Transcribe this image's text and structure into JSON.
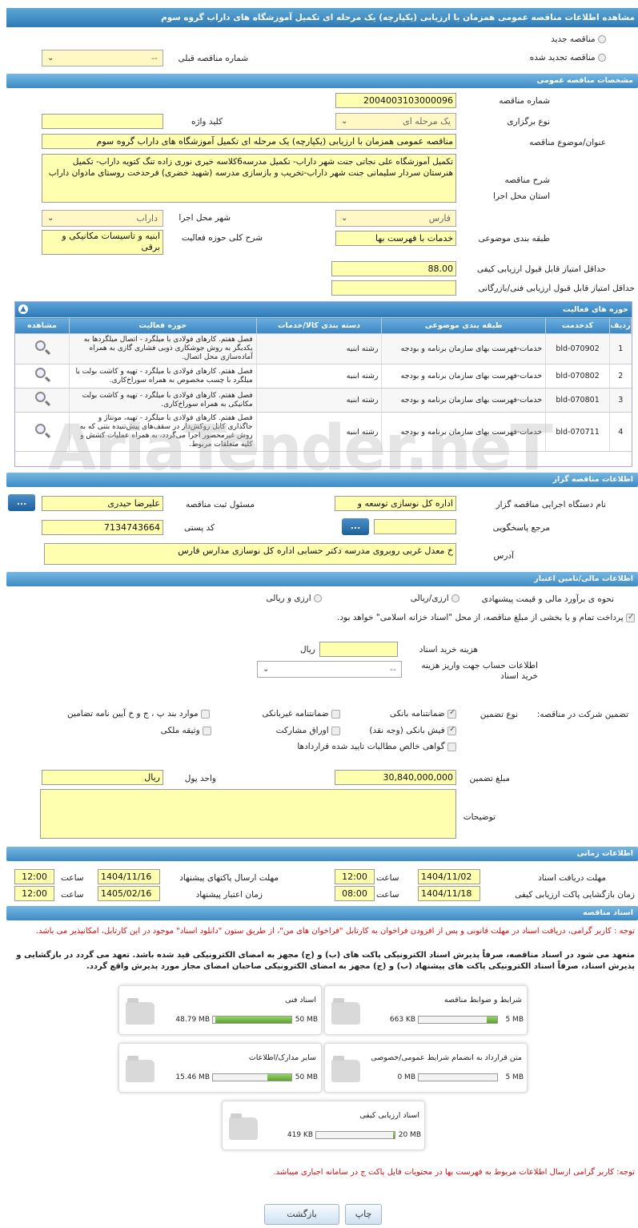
{
  "title": "مشاهده اطلاعات مناقصه عمومی همزمان با ارزیابی (یکپارچه) یک مرحله ای تکمیل آموزشگاه های داراب گروه سوم",
  "top": {
    "new_tender": "مناقصه جدید",
    "renewed_tender": "مناقصه تجدید شده",
    "prev_tender_label": "شماره مناقصه قبلی",
    "prev_tender_value": "--"
  },
  "general": {
    "header": "مشخصات مناقصه عمومی",
    "tender_no_label": "شماره مناقصه",
    "tender_no": "2004003103000096",
    "type_label": "نوع برگزاری",
    "type_value": "یک مرحله ای",
    "keyword_label": "کلید واژه",
    "keyword_value": "",
    "subject_label": "عنوان/موضوع مناقصه",
    "subject_value": "مناقصه عمومی همزمان با ارزیابی (یکپارچه) یک مرحله ای تکمیل آموزشگاه های داراب گروه سوم",
    "desc_label": "شرح مناقصه",
    "desc_value": "تکمیل آموزشگاه علی نجاتی جنت شهر داراب- تکمیل مدرسه6کلاسه خیری نوری زاده تنگ کتویه داراب- تکمیل هنرستان سردار سلیمانی جنت شهر داراب-تخریب و بازسازی مدرسه (شهید خضری) فرحدخت روستای مادوان داراب",
    "province_label": "استان محل اجرا",
    "province_value": "فارس",
    "city_label": "شهر محل اجرا",
    "city_value": "داراب",
    "category_label": "طبقه بندی موضوعی",
    "category_value": "خدمات با فهرست بها",
    "scope_label": "شرح کلی حوزه فعالیت",
    "scope_value": "ابنیه و تاسیسات مکانیکی و برقی",
    "min_quality_label": "حداقل امتیاز قابل قبول ارزیابی کیفی",
    "min_quality_value": "88.00",
    "min_tech_label": "حداقل امتیاز قابل قبول ارزیابی فنی/بازرگانی",
    "min_tech_value": ""
  },
  "activities": {
    "header": "حوزه های فعالیت",
    "columns": [
      "ردیف",
      "کدخدمت",
      "طبقه بندی موضوعی",
      "دسته بندی کالا/خدمات",
      "حوزه فعالیت",
      "مشاهده"
    ],
    "rows": [
      {
        "idx": "1",
        "code": "bld-070902",
        "category": "خدمات-فهرست بهای سازمان برنامه و بودجه",
        "group": "رشته ابنیه",
        "scope": "فصل هفتم. کارهای فولادی با میلگرد - اتصال میلگردها به یکدیگر به روش جوشکاری ذوبی فشاری گازی به همراه آماده‌سازی محل اتصال."
      },
      {
        "idx": "2",
        "code": "bld-070802",
        "category": "خدمات-فهرست بهای سازمان برنامه و بودجه",
        "group": "رشته ابنیه",
        "scope": "فصل هفتم. کارهای فولادی با میلگرد - تهیه و کاشت بولت یا میلگرد با چسب مخصوص به همراه سوراخ‌کاری."
      },
      {
        "idx": "3",
        "code": "bld-070801",
        "category": "خدمات-فهرست بهای سازمان برنامه و بودجه",
        "group": "رشته ابنیه",
        "scope": "فصل هفتم. کارهای فولادی با میلگرد - تهیه و کاشت بولت مکانیکی به همراه سوراخ‌کاری."
      },
      {
        "idx": "4",
        "code": "bld-070711",
        "category": "خدمات-فهرست بهای سازمان برنامه و بودجه",
        "group": "رشته ابنیه",
        "scope": "فصل هفتم. کارهای فولادی با میلگرد - تهیه، مونتاژ و جاگذاری کابل روکش‌دار در سقف‌های پیش‌تنیده بتنی که به روش غیرمحصور اجرا می‌گردد، به همراه عملیات کشش و کلیه متعلقات مربوط."
      }
    ]
  },
  "organizer": {
    "header": "اطلاعات مناقصه گزار",
    "org_label": "نام دستگاه اجرایی مناقصه گزار",
    "org_value": "اداره کل نوسازی  توسعه و",
    "resp_label": "مسئول ثبت مناقصه",
    "resp_value": "علیرضا حیدری",
    "ref_label": "مرجع پاسخگویی",
    "ref_value": "",
    "postal_label": "کد پستی",
    "postal_value": "7134743664",
    "address_label": "آدرس",
    "address_value": "خ معدل غربی روبروی مدرسه دکتر حسابی اداره کل نوسازی مدارس فارس",
    "dots": "..."
  },
  "finance": {
    "header": "اطلاعات مالی/تامین اعتبار",
    "estimate_label": "نحوه ی برآورد مالی و قیمت پیشنهادی",
    "opt1": "ارزی/ریالی",
    "opt2": "ارزی و ریالی",
    "treasury_text": "پرداخت تمام و یا بخشی از مبلغ مناقصه، از محل \"اسناد خزانه اسلامی\" خواهد بود.",
    "doc_cost_label": "هزینه خرید اسناد",
    "doc_cost_unit": "ریال",
    "doc_cost_value": "",
    "account_label": "اطلاعات حساب جهت واریز هزینه خرید اسناد",
    "account_value": "--"
  },
  "guarantee": {
    "label": "تضمین شرکت در مناقصه:",
    "type_label": "نوع تضمین",
    "bank_guarantee": "ضمانتنامه بانکی",
    "non_bank_guarantee": "ضمانتنامه غیربانکی",
    "clause_items": "موارد بند پ ، ج و خ آیین نامه تضامین",
    "bank_receipt": "فیش بانکی (وجه نقد)",
    "bonds": "اوراق مشارکت",
    "property": "وثیقه ملکی",
    "certificate": "گواهی خالص مطالبات تایید شده قراردادها",
    "amount_label": "مبلغ تضمین",
    "amount_value": "30,840,000,000",
    "currency_label": "واحد پول",
    "currency_value": "ریال",
    "notes_label": "توضیحات",
    "notes_value": ""
  },
  "timing": {
    "header": "اطلاعات زمانی",
    "receive_label": "مهلت دریافت اسناد",
    "receive_date": "1404/11/02",
    "receive_time": "12:00",
    "send_label": "مهلت ارسال پاکتهای پیشنهاد",
    "send_date": "1404/11/16",
    "send_time": "12:00",
    "open_label": "زمان بازگشایی پاکت ارزیابی کیفی",
    "open_date": "1404/11/18",
    "open_time": "08:00",
    "valid_label": "زمان اعتبار پیشنهاد",
    "valid_date": "1405/02/16",
    "valid_time": "12:00",
    "time_label": "ساعت"
  },
  "docs": {
    "header": "اسناد مناقصه",
    "notice1": "توجه : کاربر گرامی، دریافت اسناد در مهلت قانونی و پس از افزودن فراخوان به کارتابل \"فراخوان های من\"، از طریق ستون \"دانلود اسناد\" موجود در این کارتابل، امکانپذیر می باشد.",
    "notice2": "متعهد می شود در اسناد مناقصه، صرفاً پذیرش اسناد الکترونیکی پاکت های (ب) و (ج) مجهز به امضای الکترونیکی قید شده باشد. تعهد می گردد در بازگشایی و پذیرش اسناد، صرفاً اسناد الکترونیکی پاکت های پیشنهاد (ب) و (ج) مجهز به امضای الکترونیکی صاحبان امضای مجاز مورد پذیرش واقع گردد.",
    "files": [
      {
        "name": "شرایط و ضوابط مناقصه",
        "size": "663 KB",
        "max": "5 MB",
        "fill": 0.13
      },
      {
        "name": "اسناد فنی",
        "size": "48.79 MB",
        "max": "50 MB",
        "fill": 0.97
      },
      {
        "name": "متن قرارداد به انضمام شرایط عمومی/خصوصی",
        "size": "0 MB",
        "max": "5 MB",
        "fill": 0.0
      },
      {
        "name": "سایر مدارک/اطلاعات",
        "size": "15.46 MB",
        "max": "50 MB",
        "fill": 0.31
      },
      {
        "name": "اسناد ارزیابی کیفی",
        "size": "419 KB",
        "max": "20 MB",
        "fill": 0.02
      }
    ],
    "notice3": "توجه: کاربر گرامی ارسال اطلاعات مربوط به فهرست بها در محتویات فایل پاکت ج در سامانه اجباری میباشد."
  },
  "buttons": {
    "print": "چاپ",
    "back": "بازگشت"
  },
  "watermark": "AriaTender.neT"
}
